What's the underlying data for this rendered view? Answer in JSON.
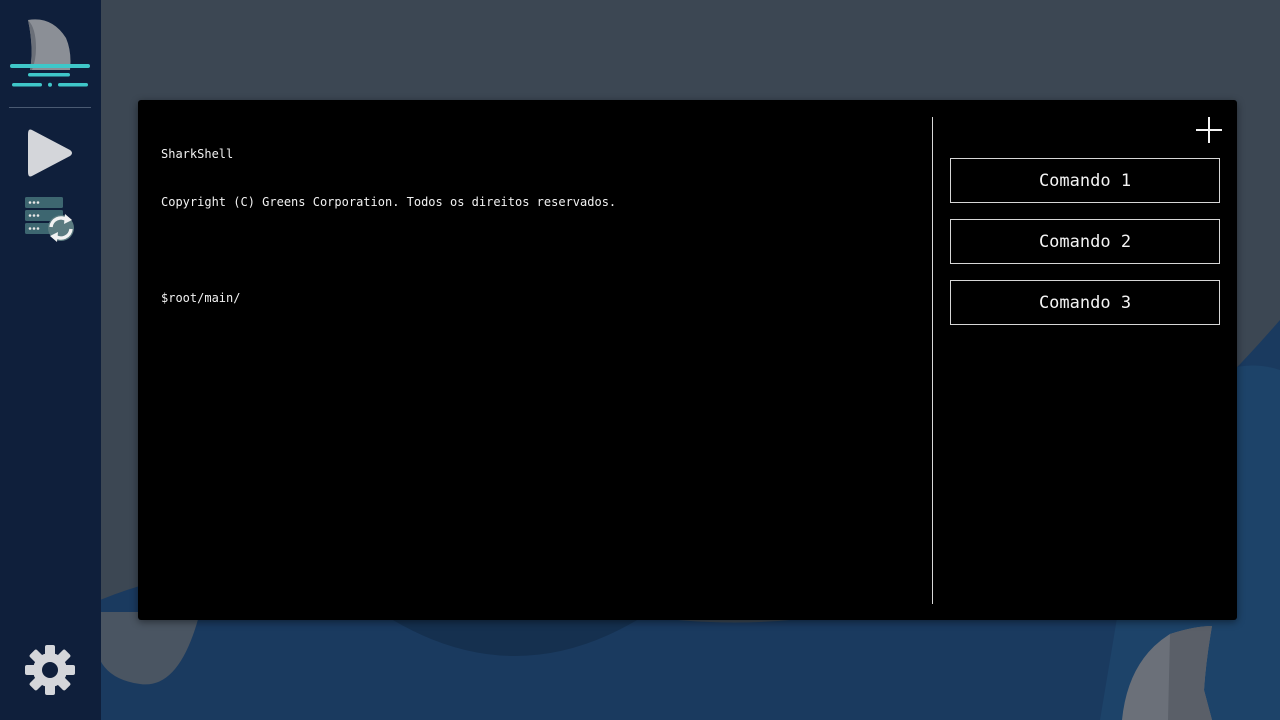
{
  "sidebar": {
    "logo_icon": "shark-fin-logo-icon",
    "items": [
      {
        "icon": "play-icon"
      },
      {
        "icon": "server-sync-icon"
      }
    ],
    "settings_icon": "gear-icon"
  },
  "terminal": {
    "lines": [
      "SharkShell",
      "Copyright (C) Greens Corporation. Todos os direitos reservados.",
      "",
      "$root/main/"
    ]
  },
  "commands": {
    "add_icon": "plus-icon",
    "items": [
      {
        "label": "Comando 1"
      },
      {
        "label": "Comando 2"
      },
      {
        "label": "Comando 3"
      }
    ]
  },
  "colors": {
    "sidebar_bg": "#0f1f3b",
    "page_bg": "#3c4753",
    "wave_blue": "#1a3a5f",
    "accent_teal": "#3fc7c9",
    "fin_gray": "#6a6f78"
  }
}
